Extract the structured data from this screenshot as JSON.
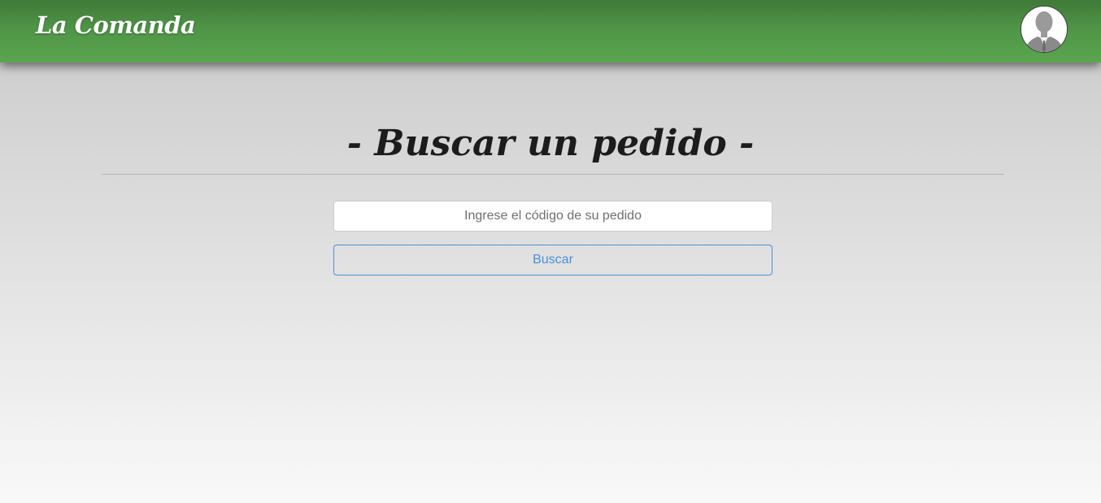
{
  "navbar": {
    "brand": "La Comanda",
    "avatar_icon": "user-avatar-icon"
  },
  "main": {
    "title": "- Buscar un pedido -",
    "search": {
      "placeholder": "Ingrese el código de su pedido",
      "value": ""
    },
    "search_button_label": "Buscar"
  },
  "colors": {
    "navbar_green": "#4f9447",
    "button_accent": "#4a90d9",
    "title_text": "#1c1c1c"
  }
}
